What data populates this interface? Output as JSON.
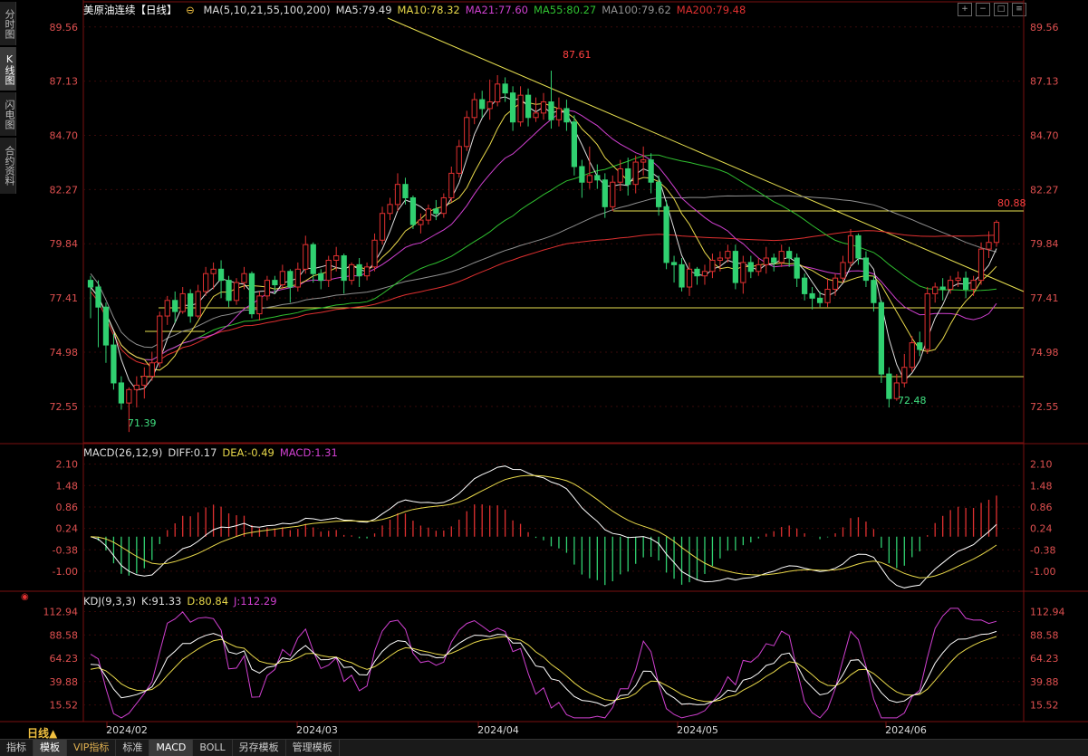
{
  "side_tabs": [
    {
      "label": "分时图",
      "active": false
    },
    {
      "label": "K线图",
      "active": true
    },
    {
      "label": "闪电图",
      "active": false
    },
    {
      "label": "合约资料",
      "active": false
    }
  ],
  "main_header": {
    "title": "美原油连续【日线】",
    "items": [
      {
        "text": "MA(5,10,21,55,100,200)",
        "color": "#dddddd"
      },
      {
        "text": "MA5:79.49",
        "color": "#dddddd"
      },
      {
        "text": "MA10:78.32",
        "color": "#e8d84a"
      },
      {
        "text": "MA21:77.60",
        "color": "#d040d0"
      },
      {
        "text": "MA55:80.27",
        "color": "#30c030"
      },
      {
        "text": "MA100:79.62",
        "color": "#909090"
      },
      {
        "text": "MA200:79.48",
        "color": "#e03030"
      }
    ]
  },
  "price_axis": [
    "89.56",
    "87.13",
    "84.70",
    "82.27",
    "79.84",
    "77.41",
    "74.98",
    "72.55"
  ],
  "annotations": {
    "high": "87.61",
    "low_left": "71.39",
    "low_right": "72.48",
    "last": "80.88"
  },
  "macd_header": {
    "items": [
      {
        "text": "MACD(26,12,9)",
        "color": "#dddddd"
      },
      {
        "text": "DIFF:0.17",
        "color": "#dddddd"
      },
      {
        "text": "DEA:-0.49",
        "color": "#e8d84a"
      },
      {
        "text": "MACD:1.31",
        "color": "#d040d0"
      }
    ]
  },
  "macd_axis": [
    "2.10",
    "1.48",
    "0.86",
    "0.24",
    "-0.38",
    "-1.00"
  ],
  "kdj_header": {
    "items": [
      {
        "text": "KDJ(9,3,3)",
        "color": "#dddddd"
      },
      {
        "text": "K:91.33",
        "color": "#dddddd"
      },
      {
        "text": "D:80.84",
        "color": "#e8d84a"
      },
      {
        "text": "J:112.29",
        "color": "#d040d0"
      }
    ]
  },
  "kdj_axis": [
    "112.94",
    "88.58",
    "64.23",
    "39.88",
    "15.52"
  ],
  "date_axis": [
    "2024/02",
    "2024/03",
    "2024/04",
    "2024/05",
    "2024/06"
  ],
  "period_label": "日线▲",
  "bottom_buttons": [
    {
      "label": "指标",
      "selected": false,
      "vip": false
    },
    {
      "label": "模板",
      "selected": true,
      "vip": false
    },
    {
      "label": "VIP指标",
      "selected": false,
      "vip": true
    },
    {
      "label": "标准",
      "selected": false,
      "vip": false
    },
    {
      "label": "MACD",
      "selected": true,
      "vip": false
    },
    {
      "label": "BOLL",
      "selected": false,
      "vip": false
    },
    {
      "label": "另存模板",
      "selected": false,
      "vip": false
    },
    {
      "label": "管理模板",
      "selected": false,
      "vip": false
    }
  ],
  "chart_data": {
    "type": "candlestick",
    "price_range": [
      71.0,
      90.2
    ],
    "candles": [
      [
        78.2,
        77.9,
        76.5,
        78.4
      ],
      [
        77.9,
        77.0,
        75.2,
        78.2
      ],
      [
        77.0,
        75.3,
        74.5,
        77.2
      ],
      [
        75.3,
        73.6,
        73.3,
        75.8
      ],
      [
        73.6,
        72.7,
        72.4,
        73.9
      ],
      [
        72.7,
        73.3,
        71.4,
        73.4
      ],
      [
        73.3,
        73.5,
        72.5,
        73.9
      ],
      [
        73.5,
        73.9,
        72.9,
        74.3
      ],
      [
        73.9,
        74.5,
        73.7,
        75.0
      ],
      [
        74.5,
        76.6,
        74.3,
        76.8
      ],
      [
        76.6,
        77.3,
        76.2,
        77.5
      ],
      [
        77.3,
        76.8,
        76.3,
        77.7
      ],
      [
        76.8,
        77.6,
        76.7,
        77.9
      ],
      [
        77.6,
        76.6,
        76.3,
        77.8
      ],
      [
        76.6,
        77.7,
        76.5,
        78.0
      ],
      [
        77.7,
        78.5,
        77.5,
        78.8
      ],
      [
        78.5,
        78.7,
        77.8,
        79.0
      ],
      [
        78.7,
        78.2,
        77.4,
        79.1
      ],
      [
        78.2,
        77.3,
        77.0,
        78.4
      ],
      [
        77.3,
        78.1,
        77.1,
        78.3
      ],
      [
        78.1,
        78.5,
        77.8,
        78.8
      ],
      [
        78.5,
        76.7,
        76.5,
        78.6
      ],
      [
        76.7,
        77.5,
        76.4,
        77.7
      ],
      [
        77.5,
        78.2,
        77.3,
        78.4
      ],
      [
        78.2,
        78.0,
        77.6,
        78.4
      ],
      [
        78.0,
        78.6,
        77.8,
        78.9
      ],
      [
        78.6,
        77.9,
        77.2,
        78.7
      ],
      [
        77.9,
        78.7,
        77.7,
        79.0
      ],
      [
        78.7,
        79.8,
        78.5,
        80.2
      ],
      [
        79.8,
        78.5,
        78.1,
        79.9
      ],
      [
        78.5,
        78.2,
        77.8,
        78.7
      ],
      [
        78.2,
        79.1,
        77.9,
        79.3
      ],
      [
        79.1,
        79.3,
        78.6,
        79.7
      ],
      [
        79.3,
        78.2,
        77.6,
        79.4
      ],
      [
        78.2,
        78.9,
        78.0,
        79.0
      ],
      [
        78.9,
        78.4,
        77.9,
        79.2
      ],
      [
        78.4,
        78.8,
        78.2,
        79.0
      ],
      [
        78.8,
        80.0,
        78.6,
        80.3
      ],
      [
        80.0,
        81.2,
        79.8,
        81.5
      ],
      [
        81.2,
        81.6,
        80.9,
        81.9
      ],
      [
        81.6,
        82.5,
        81.3,
        83.0
      ],
      [
        82.5,
        81.9,
        81.6,
        82.8
      ],
      [
        81.9,
        80.7,
        80.5,
        82.0
      ],
      [
        80.7,
        80.9,
        80.3,
        81.2
      ],
      [
        80.9,
        81.4,
        80.7,
        81.6
      ],
      [
        81.4,
        81.2,
        80.9,
        81.8
      ],
      [
        81.2,
        81.9,
        81.0,
        82.1
      ],
      [
        81.9,
        83.0,
        81.7,
        83.3
      ],
      [
        83.0,
        84.2,
        82.8,
        84.5
      ],
      [
        84.2,
        85.5,
        84.0,
        85.8
      ],
      [
        85.5,
        86.3,
        85.2,
        86.6
      ],
      [
        86.3,
        85.9,
        85.5,
        86.7
      ],
      [
        85.9,
        86.2,
        85.4,
        87.2
      ],
      [
        86.2,
        87.0,
        86.0,
        87.4
      ],
      [
        87.0,
        86.6,
        86.2,
        87.3
      ],
      [
        86.6,
        85.3,
        84.9,
        86.9
      ],
      [
        85.3,
        86.5,
        85.1,
        86.9
      ],
      [
        86.5,
        85.5,
        85.1,
        86.8
      ],
      [
        85.5,
        85.7,
        85.3,
        86.4
      ],
      [
        85.7,
        86.2,
        85.4,
        86.6
      ],
      [
        86.2,
        85.4,
        85.0,
        87.6
      ],
      [
        85.4,
        85.9,
        85.1,
        86.4
      ],
      [
        85.9,
        85.3,
        84.9,
        86.3
      ],
      [
        85.3,
        83.3,
        82.9,
        85.6
      ],
      [
        83.3,
        82.6,
        81.9,
        83.6
      ],
      [
        82.6,
        82.9,
        82.3,
        84.2
      ],
      [
        82.9,
        82.7,
        82.3,
        83.4
      ],
      [
        82.7,
        81.5,
        81.0,
        83.0
      ],
      [
        81.5,
        82.6,
        81.3,
        82.9
      ],
      [
        82.6,
        83.2,
        82.2,
        83.6
      ],
      [
        83.2,
        82.5,
        82.0,
        83.7
      ],
      [
        82.5,
        83.5,
        82.1,
        83.8
      ],
      [
        83.5,
        83.6,
        82.9,
        84.2
      ],
      [
        83.6,
        82.6,
        82.1,
        83.9
      ],
      [
        82.6,
        81.5,
        81.1,
        82.9
      ],
      [
        81.5,
        79.0,
        78.7,
        81.8
      ],
      [
        79.0,
        78.9,
        78.1,
        79.3
      ],
      [
        78.9,
        77.9,
        77.7,
        79.2
      ],
      [
        77.9,
        78.7,
        77.5,
        79.0
      ],
      [
        78.7,
        78.4,
        78.0,
        78.8
      ],
      [
        78.4,
        78.6,
        78.0,
        78.9
      ],
      [
        78.6,
        79.1,
        78.3,
        79.4
      ],
      [
        79.1,
        79.2,
        78.6,
        79.5
      ],
      [
        79.2,
        79.5,
        79.0,
        79.8
      ],
      [
        79.5,
        78.1,
        77.8,
        79.8
      ],
      [
        78.1,
        79.0,
        77.6,
        79.3
      ],
      [
        79.0,
        78.6,
        78.3,
        79.3
      ],
      [
        78.6,
        78.9,
        78.4,
        79.2
      ],
      [
        78.9,
        79.2,
        78.5,
        79.7
      ],
      [
        79.2,
        79.0,
        78.6,
        79.4
      ],
      [
        79.0,
        79.5,
        78.8,
        79.8
      ],
      [
        79.5,
        79.2,
        78.8,
        79.7
      ],
      [
        79.2,
        78.3,
        77.9,
        79.4
      ],
      [
        78.3,
        77.6,
        77.3,
        78.5
      ],
      [
        77.6,
        77.4,
        76.9,
        77.9
      ],
      [
        77.4,
        77.2,
        77.0,
        77.7
      ],
      [
        77.2,
        77.8,
        77.0,
        78.3
      ],
      [
        77.8,
        78.3,
        77.5,
        78.5
      ],
      [
        78.3,
        79.0,
        78.1,
        79.3
      ],
      [
        79.0,
        80.2,
        78.8,
        80.5
      ],
      [
        80.2,
        79.2,
        78.9,
        80.3
      ],
      [
        79.2,
        78.2,
        77.9,
        79.5
      ],
      [
        78.2,
        77.2,
        76.8,
        78.4
      ],
      [
        77.2,
        74.0,
        73.6,
        77.3
      ],
      [
        74.0,
        72.9,
        72.5,
        74.3
      ],
      [
        72.9,
        73.6,
        72.8,
        74.0
      ],
      [
        73.6,
        74.3,
        73.4,
        74.9
      ],
      [
        74.3,
        75.4,
        74.1,
        75.7
      ],
      [
        75.4,
        75.1,
        74.8,
        75.9
      ],
      [
        75.1,
        77.6,
        74.9,
        77.9
      ],
      [
        77.6,
        77.9,
        77.2,
        78.1
      ],
      [
        77.9,
        77.8,
        77.3,
        78.3
      ],
      [
        77.8,
        78.2,
        77.6,
        78.4
      ],
      [
        78.2,
        78.3,
        77.9,
        78.6
      ],
      [
        78.3,
        77.8,
        77.4,
        78.6
      ],
      [
        77.8,
        78.2,
        77.5,
        78.4
      ],
      [
        78.2,
        79.6,
        78.0,
        79.9
      ],
      [
        79.6,
        79.9,
        79.2,
        80.4
      ],
      [
        79.9,
        80.8,
        79.7,
        80.9
      ]
    ],
    "macd_range": [
      -1.5,
      2.3
    ],
    "kdj_range": [
      0,
      120
    ]
  }
}
